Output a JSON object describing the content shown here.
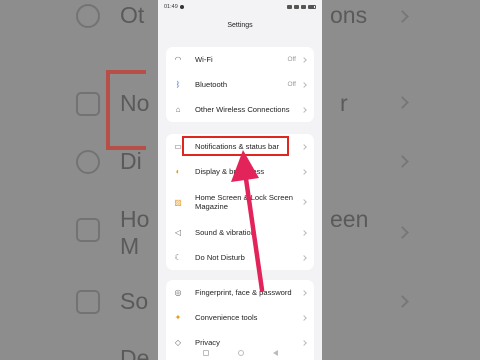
{
  "status_bar": {
    "time": "01:49"
  },
  "screen_title": "Settings",
  "groups": [
    {
      "items": [
        {
          "icon": "wifi-icon",
          "label": "Wi-Fi",
          "value": "Off"
        },
        {
          "icon": "bluetooth-icon",
          "label": "Bluetooth",
          "value": "Off"
        },
        {
          "icon": "wireless-connections-icon",
          "label": "Other Wireless Connections",
          "value": ""
        }
      ]
    },
    {
      "items": [
        {
          "icon": "notifications-icon",
          "label": "Notifications & status bar",
          "value": ""
        },
        {
          "icon": "display-icon",
          "label": "Display & brightness",
          "value": ""
        },
        {
          "icon": "home-screen-icon",
          "label": "Home Screen & Lock Screen Magazine",
          "value": ""
        },
        {
          "icon": "sound-icon",
          "label": "Sound & vibration",
          "value": ""
        },
        {
          "icon": "moon-icon",
          "label": "Do Not Disturb",
          "value": ""
        }
      ]
    },
    {
      "items": [
        {
          "icon": "fingerprint-icon",
          "label": "Fingerprint, face & password",
          "value": ""
        },
        {
          "icon": "convenience-tools-icon",
          "label": "Convenience tools",
          "value": ""
        },
        {
          "icon": "privacy-icon",
          "label": "Privacy",
          "value": ""
        }
      ]
    }
  ],
  "background": {
    "rows": [
      "Ot",
      "ons",
      "No",
      "r",
      "Di",
      "Ho",
      "een",
      "M",
      "So",
      "De"
    ]
  },
  "annotation": {
    "highlight_color": "#e0271f",
    "arrow_color": "#e3245a"
  }
}
